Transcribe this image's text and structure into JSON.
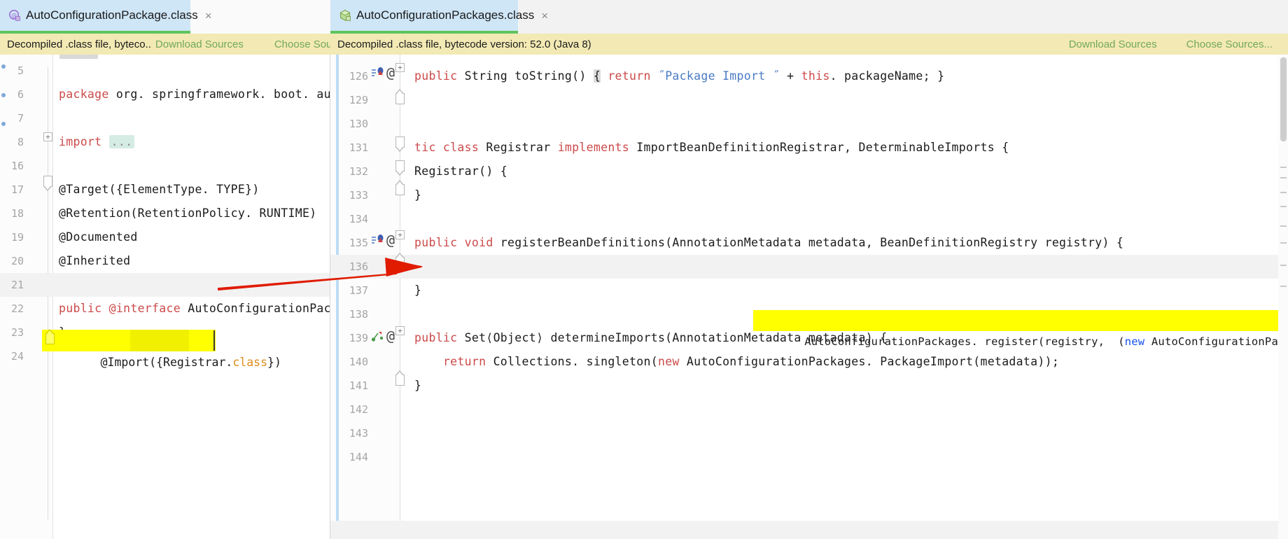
{
  "window": {
    "app": "IntelliJ IDEA Decompiled Class Viewer"
  },
  "tabs": [
    {
      "id": "tab-left",
      "label": "AutoConfigurationPackage.class",
      "icon": "annotation-class-icon",
      "close_glyph": "×",
      "active": true
    },
    {
      "id": "tab-right",
      "label": "AutoConfigurationPackages.class",
      "icon": "java-class-icon",
      "close_glyph": "×",
      "active": true
    }
  ],
  "notifications": {
    "left": {
      "message": "Decompiled .class file, byteco..",
      "download_sources": "Download Sources",
      "choose_sources": "Choose Sources..."
    },
    "right": {
      "message": "Decompiled .class file, bytecode version: 52.0 (Java 8)",
      "download_sources": "Download Sources",
      "choose_sources": "Choose Sources..."
    }
  },
  "colors": {
    "tab_active_bg": "#cfe6f7",
    "tab_underline": "#5fc45f",
    "notification_bg": "#f2e9b4",
    "link_green": "#72a85a",
    "highlight_yellow": "#ffff00",
    "arrow_red": "#e01b00",
    "keyword_red": "#cc4a4a",
    "string_blue": "#4a7ac4",
    "number_blue": "#1750eb",
    "current_line_bg": "#f2f2f2",
    "gutter_bg": "#fcfcfc",
    "line_number": "#a5a5a5"
  },
  "left_editor": {
    "file": "AutoConfigurationPackage.class",
    "lines": [
      {
        "num": "5",
        "segments": []
      },
      {
        "num": "6",
        "segments": [
          {
            "t": "package",
            "c": "kw"
          },
          {
            "t": " org. springframework. boot. autoconfigur",
            "c": "plain"
          }
        ]
      },
      {
        "num": "7",
        "segments": []
      },
      {
        "num": "8",
        "segments": [
          {
            "t": "import",
            "c": "kw"
          },
          {
            "t": " ",
            "c": "plain"
          },
          {
            "t": "...",
            "c": "fold"
          }
        ]
      },
      {
        "num": "16",
        "segments": []
      },
      {
        "num": "17",
        "segments": [
          {
            "t": "@Target({ElementType. TYPE})",
            "c": "plain"
          }
        ]
      },
      {
        "num": "18",
        "segments": [
          {
            "t": "@Retention(RetentionPolicy. RUNTIME)",
            "c": "plain"
          }
        ]
      },
      {
        "num": "19",
        "segments": [
          {
            "t": "@Documented",
            "c": "plain"
          }
        ]
      },
      {
        "num": "20",
        "segments": [
          {
            "t": "@Inherited",
            "c": "plain"
          }
        ]
      },
      {
        "num": "21",
        "segments": [],
        "highlighted": true
      },
      {
        "num": "22",
        "segments": [
          {
            "t": "public",
            "c": "kw"
          },
          {
            "t": " ",
            "c": "plain"
          },
          {
            "t": "@interface",
            "c": "kw"
          },
          {
            "t": " AutoConfigurationPackage {",
            "c": "plain"
          }
        ]
      },
      {
        "num": "23",
        "segments": [
          {
            "t": "}",
            "c": "plain"
          }
        ]
      },
      {
        "num": "24",
        "segments": []
      }
    ],
    "highlighted_line": {
      "num": "21",
      "prefix": "@Import({Registrar.",
      "keyword": "class",
      "suffix": "})"
    }
  },
  "right_editor": {
    "file": "AutoConfigurationPackages.class",
    "lines": [
      {
        "num": "126",
        "segments": [
          {
            "t": "public",
            "c": "kw"
          },
          {
            "t": " String toString() ",
            "c": "plain"
          },
          {
            "t": "{",
            "c": "sel"
          },
          {
            "t": " ",
            "c": "plain"
          },
          {
            "t": "return",
            "c": "kw"
          },
          {
            "t": " ",
            "c": "plain"
          },
          {
            "t": "˝Package Import ˝",
            "c": "str"
          },
          {
            "t": " + ",
            "c": "plain"
          },
          {
            "t": "this",
            "c": "kw"
          },
          {
            "t": ". packageName; }",
            "c": "plain"
          }
        ],
        "has_run_icon": true,
        "has_at_icon": true
      },
      {
        "num": "129",
        "segments": []
      },
      {
        "num": "130",
        "segments": []
      },
      {
        "num": "131",
        "segments": [
          {
            "t": "tic class",
            "c": "kw"
          },
          {
            "t": " Registrar ",
            "c": "plain"
          },
          {
            "t": "implements",
            "c": "kw"
          },
          {
            "t": " ImportBeanDefinitionRegistrar, DeterminableImports {",
            "c": "plain"
          }
        ]
      },
      {
        "num": "132",
        "segments": [
          {
            "t": "Registrar() {",
            "c": "plain"
          }
        ]
      },
      {
        "num": "133",
        "segments": [
          {
            "t": "}",
            "c": "plain"
          }
        ]
      },
      {
        "num": "134",
        "segments": []
      },
      {
        "num": "135",
        "segments": [
          {
            "t": "public void",
            "c": "kw"
          },
          {
            "t": " registerBeanDefinitions(AnnotationMetadata metadata, BeanDefinitionRegistry registry) {",
            "c": "plain"
          }
        ],
        "has_run_icon": true,
        "has_at_icon": true
      },
      {
        "num": "136",
        "segments": [],
        "highlighted": true
      },
      {
        "num": "137",
        "segments": [
          {
            "t": "}",
            "c": "plain"
          }
        ]
      },
      {
        "num": "138",
        "segments": []
      },
      {
        "num": "139",
        "segments": [
          {
            "t": "public",
            "c": "kw"
          },
          {
            "t": " Set⟨Object⟩ determineImports(AnnotationMetadata metadata) {",
            "c": "plain"
          }
        ],
        "has_run_icon": true,
        "has_at_icon": true
      },
      {
        "num": "140",
        "segments": [
          {
            "t": "    ",
            "c": "plain"
          },
          {
            "t": "return",
            "c": "kw"
          },
          {
            "t": " Collections. singleton(",
            "c": "plain"
          },
          {
            "t": "new",
            "c": "kw"
          },
          {
            "t": " AutoConfigurationPackages. PackageImport(metadata));",
            "c": "plain"
          }
        ]
      },
      {
        "num": "141",
        "segments": [
          {
            "t": "}",
            "c": "plain"
          }
        ]
      },
      {
        "num": "142",
        "segments": []
      },
      {
        "num": "143",
        "segments": []
      },
      {
        "num": "144",
        "segments": []
      }
    ],
    "highlighted_line": {
      "num": "136",
      "part1": "AutoConfigurationPackages. register(registry,  (",
      "keyword_new": "new",
      "part2": " AutoConfigurationPackages. PackageImport(metadata)). getPackage"
    }
  },
  "annotation": {
    "type": "red-arrow",
    "from": "left line 21 @Import({Registrar.class})",
    "to": "right line 136 AutoConfigurationPackages.register(...)"
  },
  "scrollbar": {
    "orientation": "vertical",
    "position": "right"
  }
}
